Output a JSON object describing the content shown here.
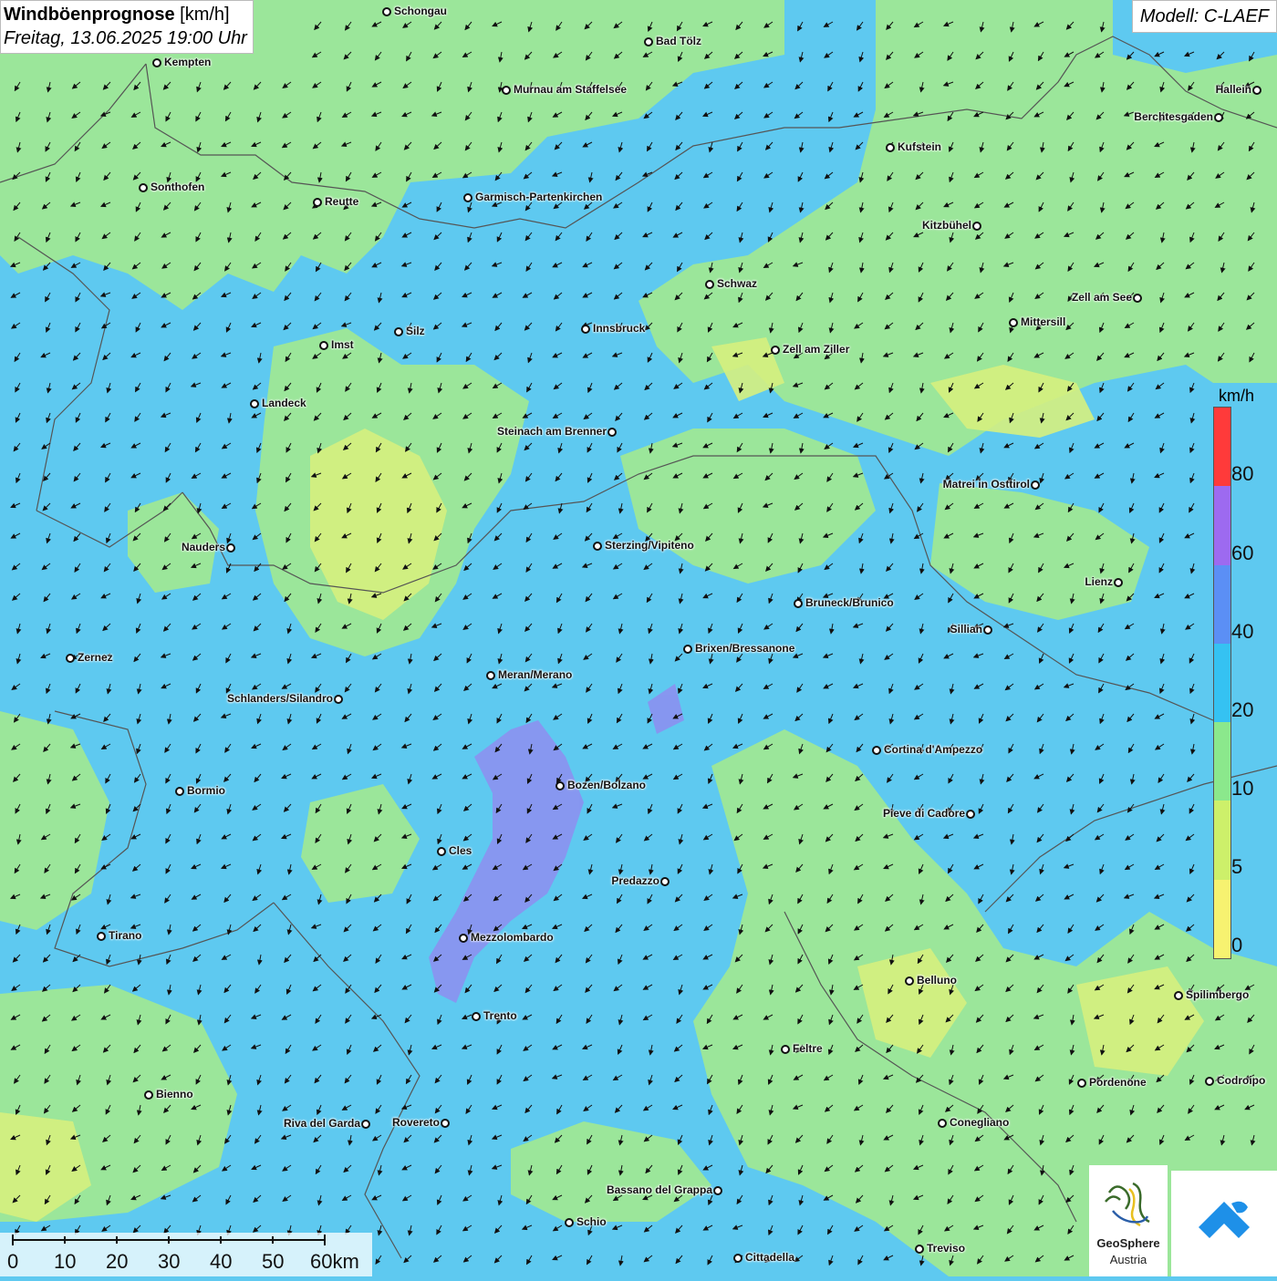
{
  "title": {
    "main": "Windböenprognose",
    "unit": "[km/h]",
    "datetime": "Freitag, 13.06.2025 19:00 Uhr"
  },
  "model": "Modell: C-LAEF",
  "legend": {
    "unit": "km/h",
    "labels": [
      "80",
      "60",
      "40",
      "20",
      "10",
      "5",
      "0"
    ],
    "colors": [
      "#ff3a3a",
      "#9d6af0",
      "#5b8ff5",
      "#35c2f2",
      "#8be88c",
      "#cdf06a",
      "#f7f270"
    ]
  },
  "scalebar": {
    "labels": [
      "0",
      "10",
      "20",
      "30",
      "40",
      "50",
      "60km"
    ]
  },
  "logos": {
    "geosphere_line1": "GeoSphere",
    "geosphere_line2": "Austria"
  },
  "colors": {
    "background_blue": "#5ec9f0",
    "green": "#9be69a",
    "yellow_green": "#d6ef7e",
    "purple": "#8e8ef0",
    "border": "#555555"
  },
  "cities": [
    {
      "name": "Schongau"
    },
    {
      "name": "Bad Tölz"
    },
    {
      "name": "Kempten"
    },
    {
      "name": "Hallein"
    },
    {
      "name": "Murnau am Staffelsee"
    },
    {
      "name": "Berchtesgaden"
    },
    {
      "name": "Kufstein"
    },
    {
      "name": "Sonthofen"
    },
    {
      "name": "Reutte"
    },
    {
      "name": "Garmisch-Partenkirchen"
    },
    {
      "name": "Kitzbühel"
    },
    {
      "name": "Schwaz"
    },
    {
      "name": "Zell am See"
    },
    {
      "name": "Mittersill"
    },
    {
      "name": "Innsbruck"
    },
    {
      "name": "Silz"
    },
    {
      "name": "Imst"
    },
    {
      "name": "Zell am Ziller"
    },
    {
      "name": "Landeck"
    },
    {
      "name": "Steinach am Brenner"
    },
    {
      "name": "Matrei in Osttirol"
    },
    {
      "name": "Nauders"
    },
    {
      "name": "Sterzing/Vipiteno"
    },
    {
      "name": "Lienz"
    },
    {
      "name": "Bruneck/Brunico"
    },
    {
      "name": "Sillian"
    },
    {
      "name": "Brixen/Bressanone"
    },
    {
      "name": "Zernez"
    },
    {
      "name": "Meran/Merano"
    },
    {
      "name": "Schlanders/Silandro"
    },
    {
      "name": "Cortina d'Ampezzo"
    },
    {
      "name": "Bozen/Bolzano"
    },
    {
      "name": "Bormio"
    },
    {
      "name": "Pieve di Cadore"
    },
    {
      "name": "Cles"
    },
    {
      "name": "Predazzo"
    },
    {
      "name": "Tirano"
    },
    {
      "name": "Mezzolombardo"
    },
    {
      "name": "Belluno"
    },
    {
      "name": "Spilimbergo"
    },
    {
      "name": "Trento"
    },
    {
      "name": "Feltre"
    },
    {
      "name": "Bienno"
    },
    {
      "name": "Pordenone"
    },
    {
      "name": "Codroipo"
    },
    {
      "name": "Riva del Garda"
    },
    {
      "name": "Rovereto"
    },
    {
      "name": "Conegliano"
    },
    {
      "name": "Bassano del Grappa"
    },
    {
      "name": "Schio"
    },
    {
      "name": "Treviso"
    },
    {
      "name": "Cittadella"
    }
  ]
}
